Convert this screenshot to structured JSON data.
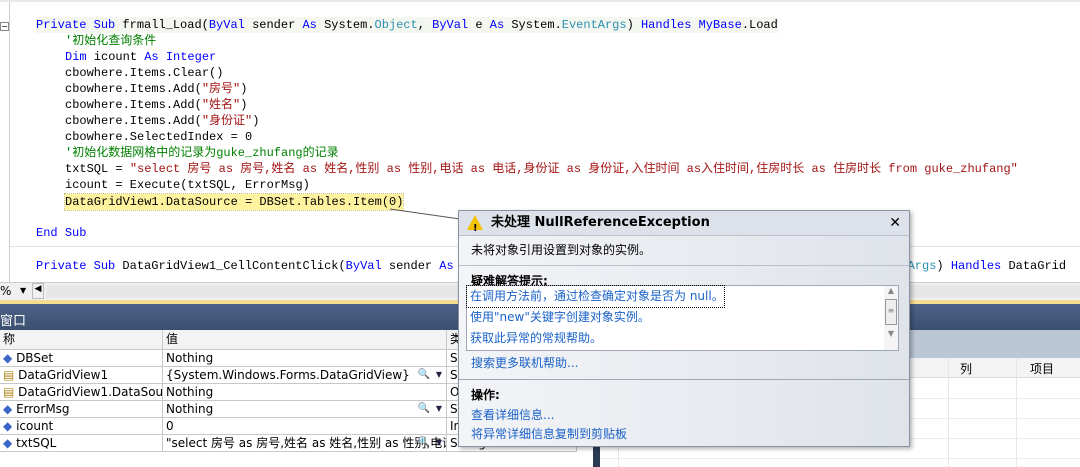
{
  "code": {
    "l1": {
      "a": "Private",
      "b": "Sub",
      "c": " frmall_Load(",
      "d": "ByVal",
      "e": " sender ",
      "f": "As",
      "g": " System.",
      "h": "Object",
      "i": ", ",
      "j": "ByVal",
      "k": " e ",
      "l": "As",
      "m": " System.",
      "n": "EventArgs",
      "o": ") ",
      "p": "Handles",
      "q": " ",
      "r": "MyBase",
      ".s": "",
      "s": ".Load"
    },
    "l2": "'初始化查询条件",
    "l3": {
      "a": "Dim",
      "b": " icount ",
      "c": "As",
      "d": " ",
      "e": "Integer"
    },
    "l4": "cbowhere.Items.Clear()",
    "l5": {
      "a": "cbowhere.Items.Add(",
      "b": "\"房号\"",
      "c": ")"
    },
    "l6": {
      "a": "cbowhere.Items.Add(",
      "b": "\"姓名\"",
      "c": ")"
    },
    "l7": {
      "a": "cbowhere.Items.Add(",
      "b": "\"身份证\"",
      "c": ")"
    },
    "l8": "cbowhere.SelectedIndex = 0",
    "l9": "'初始化数据网格中的记录为guke_zhufang的记录",
    "l10": {
      "a": "txtSQL = ",
      "b": "\"select 房号 as 房号,姓名 as 姓名,性别 as 性别,电话 as 电话,身份证 as 身份证,入住时间 as入住时间,住房时长 as 住房时长 from guke_zhufang\""
    },
    "l11": "icount = Execute(txtSQL, ErrorMsg)",
    "l12": "DataGridView1.DataSource = DBSet.Tables.Item(0)",
    "l13": {
      "a": "End",
      "b": " ",
      "c": "Sub"
    },
    "l14": {
      "a": "Private",
      "b": "Sub",
      "c": " DataGridView1_CellContentClick(",
      "d": "ByVal",
      "e": " sender ",
      "f": "As",
      "g": " Sy",
      "h": "entArgs",
      "i": ") ",
      "j": "Handles",
      "k": " DataGrid"
    }
  },
  "toolbar": {
    "zoom": "%"
  },
  "locals": {
    "title": "窗口",
    "headers": [
      "称",
      "值",
      "类"
    ],
    "rows": [
      {
        "name": "DBSet",
        "value": "Nothing",
        "type": "S"
      },
      {
        "name": "DataGridView1",
        "value": "{System.Windows.Forms.DataGridView}",
        "type": "S"
      },
      {
        "name": "DataGridView1.DataSource",
        "value": "Nothing",
        "type": "O"
      },
      {
        "name": "ErrorMsg",
        "value": "Nothing",
        "type": "S"
      },
      {
        "name": "icount",
        "value": "0",
        "type": "In"
      },
      {
        "name": "txtSQL",
        "value": "\"select 房号 as 房号,姓名 as 姓名,性别 as 性别,电话",
        "type": "String"
      }
    ]
  },
  "right_pane": {
    "col_label": "列",
    "item_label": "项目"
  },
  "exception": {
    "title": "未处理 NullReferenceException",
    "message": "未将对象引用设置到对象的实例。",
    "tips_heading": "疑难解答提示:",
    "tips": [
      "在调用方法前，通过检查确定对象是否为 null。",
      "使用\"new\"关键字创建对象实例。",
      "获取此异常的常规帮助。"
    ],
    "more_help": "搜索更多联机帮助...",
    "actions_heading": "操作:",
    "actions": [
      "查看详细信息...",
      "将异常详细信息复制到剪贴板"
    ]
  }
}
